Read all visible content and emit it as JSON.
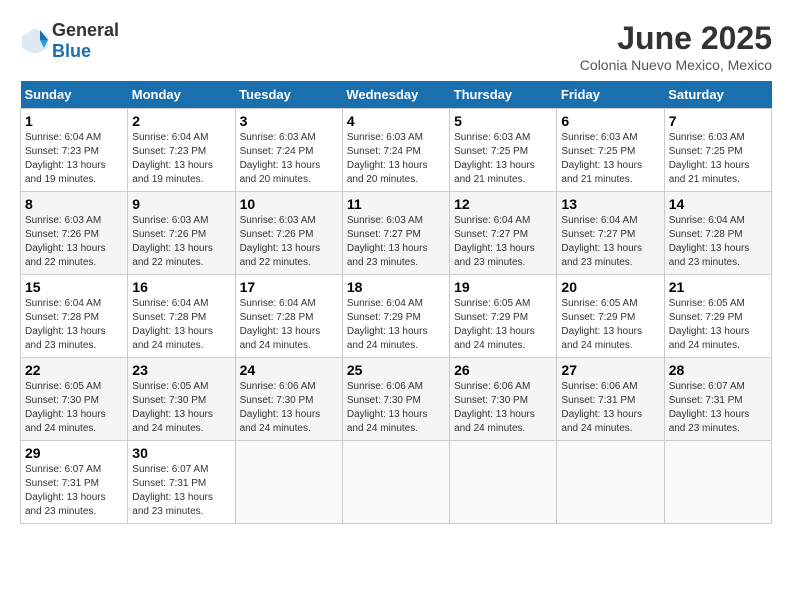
{
  "header": {
    "logo_general": "General",
    "logo_blue": "Blue",
    "title": "June 2025",
    "subtitle": "Colonia Nuevo Mexico, Mexico"
  },
  "days_of_week": [
    "Sunday",
    "Monday",
    "Tuesday",
    "Wednesday",
    "Thursday",
    "Friday",
    "Saturday"
  ],
  "weeks": [
    [
      {
        "day": "1",
        "sunrise": "6:04 AM",
        "sunset": "7:23 PM",
        "daylight": "13 hours and 19 minutes."
      },
      {
        "day": "2",
        "sunrise": "6:04 AM",
        "sunset": "7:23 PM",
        "daylight": "13 hours and 19 minutes."
      },
      {
        "day": "3",
        "sunrise": "6:03 AM",
        "sunset": "7:24 PM",
        "daylight": "13 hours and 20 minutes."
      },
      {
        "day": "4",
        "sunrise": "6:03 AM",
        "sunset": "7:24 PM",
        "daylight": "13 hours and 20 minutes."
      },
      {
        "day": "5",
        "sunrise": "6:03 AM",
        "sunset": "7:25 PM",
        "daylight": "13 hours and 21 minutes."
      },
      {
        "day": "6",
        "sunrise": "6:03 AM",
        "sunset": "7:25 PM",
        "daylight": "13 hours and 21 minutes."
      },
      {
        "day": "7",
        "sunrise": "6:03 AM",
        "sunset": "7:25 PM",
        "daylight": "13 hours and 21 minutes."
      }
    ],
    [
      {
        "day": "8",
        "sunrise": "6:03 AM",
        "sunset": "7:26 PM",
        "daylight": "13 hours and 22 minutes."
      },
      {
        "day": "9",
        "sunrise": "6:03 AM",
        "sunset": "7:26 PM",
        "daylight": "13 hours and 22 minutes."
      },
      {
        "day": "10",
        "sunrise": "6:03 AM",
        "sunset": "7:26 PM",
        "daylight": "13 hours and 22 minutes."
      },
      {
        "day": "11",
        "sunrise": "6:03 AM",
        "sunset": "7:27 PM",
        "daylight": "13 hours and 23 minutes."
      },
      {
        "day": "12",
        "sunrise": "6:04 AM",
        "sunset": "7:27 PM",
        "daylight": "13 hours and 23 minutes."
      },
      {
        "day": "13",
        "sunrise": "6:04 AM",
        "sunset": "7:27 PM",
        "daylight": "13 hours and 23 minutes."
      },
      {
        "day": "14",
        "sunrise": "6:04 AM",
        "sunset": "7:28 PM",
        "daylight": "13 hours and 23 minutes."
      }
    ],
    [
      {
        "day": "15",
        "sunrise": "6:04 AM",
        "sunset": "7:28 PM",
        "daylight": "13 hours and 23 minutes."
      },
      {
        "day": "16",
        "sunrise": "6:04 AM",
        "sunset": "7:28 PM",
        "daylight": "13 hours and 24 minutes."
      },
      {
        "day": "17",
        "sunrise": "6:04 AM",
        "sunset": "7:28 PM",
        "daylight": "13 hours and 24 minutes."
      },
      {
        "day": "18",
        "sunrise": "6:04 AM",
        "sunset": "7:29 PM",
        "daylight": "13 hours and 24 minutes."
      },
      {
        "day": "19",
        "sunrise": "6:05 AM",
        "sunset": "7:29 PM",
        "daylight": "13 hours and 24 minutes."
      },
      {
        "day": "20",
        "sunrise": "6:05 AM",
        "sunset": "7:29 PM",
        "daylight": "13 hours and 24 minutes."
      },
      {
        "day": "21",
        "sunrise": "6:05 AM",
        "sunset": "7:29 PM",
        "daylight": "13 hours and 24 minutes."
      }
    ],
    [
      {
        "day": "22",
        "sunrise": "6:05 AM",
        "sunset": "7:30 PM",
        "daylight": "13 hours and 24 minutes."
      },
      {
        "day": "23",
        "sunrise": "6:05 AM",
        "sunset": "7:30 PM",
        "daylight": "13 hours and 24 minutes."
      },
      {
        "day": "24",
        "sunrise": "6:06 AM",
        "sunset": "7:30 PM",
        "daylight": "13 hours and 24 minutes."
      },
      {
        "day": "25",
        "sunrise": "6:06 AM",
        "sunset": "7:30 PM",
        "daylight": "13 hours and 24 minutes."
      },
      {
        "day": "26",
        "sunrise": "6:06 AM",
        "sunset": "7:30 PM",
        "daylight": "13 hours and 24 minutes."
      },
      {
        "day": "27",
        "sunrise": "6:06 AM",
        "sunset": "7:31 PM",
        "daylight": "13 hours and 24 minutes."
      },
      {
        "day": "28",
        "sunrise": "6:07 AM",
        "sunset": "7:31 PM",
        "daylight": "13 hours and 23 minutes."
      }
    ],
    [
      {
        "day": "29",
        "sunrise": "6:07 AM",
        "sunset": "7:31 PM",
        "daylight": "13 hours and 23 minutes."
      },
      {
        "day": "30",
        "sunrise": "6:07 AM",
        "sunset": "7:31 PM",
        "daylight": "13 hours and 23 minutes."
      },
      null,
      null,
      null,
      null,
      null
    ]
  ]
}
